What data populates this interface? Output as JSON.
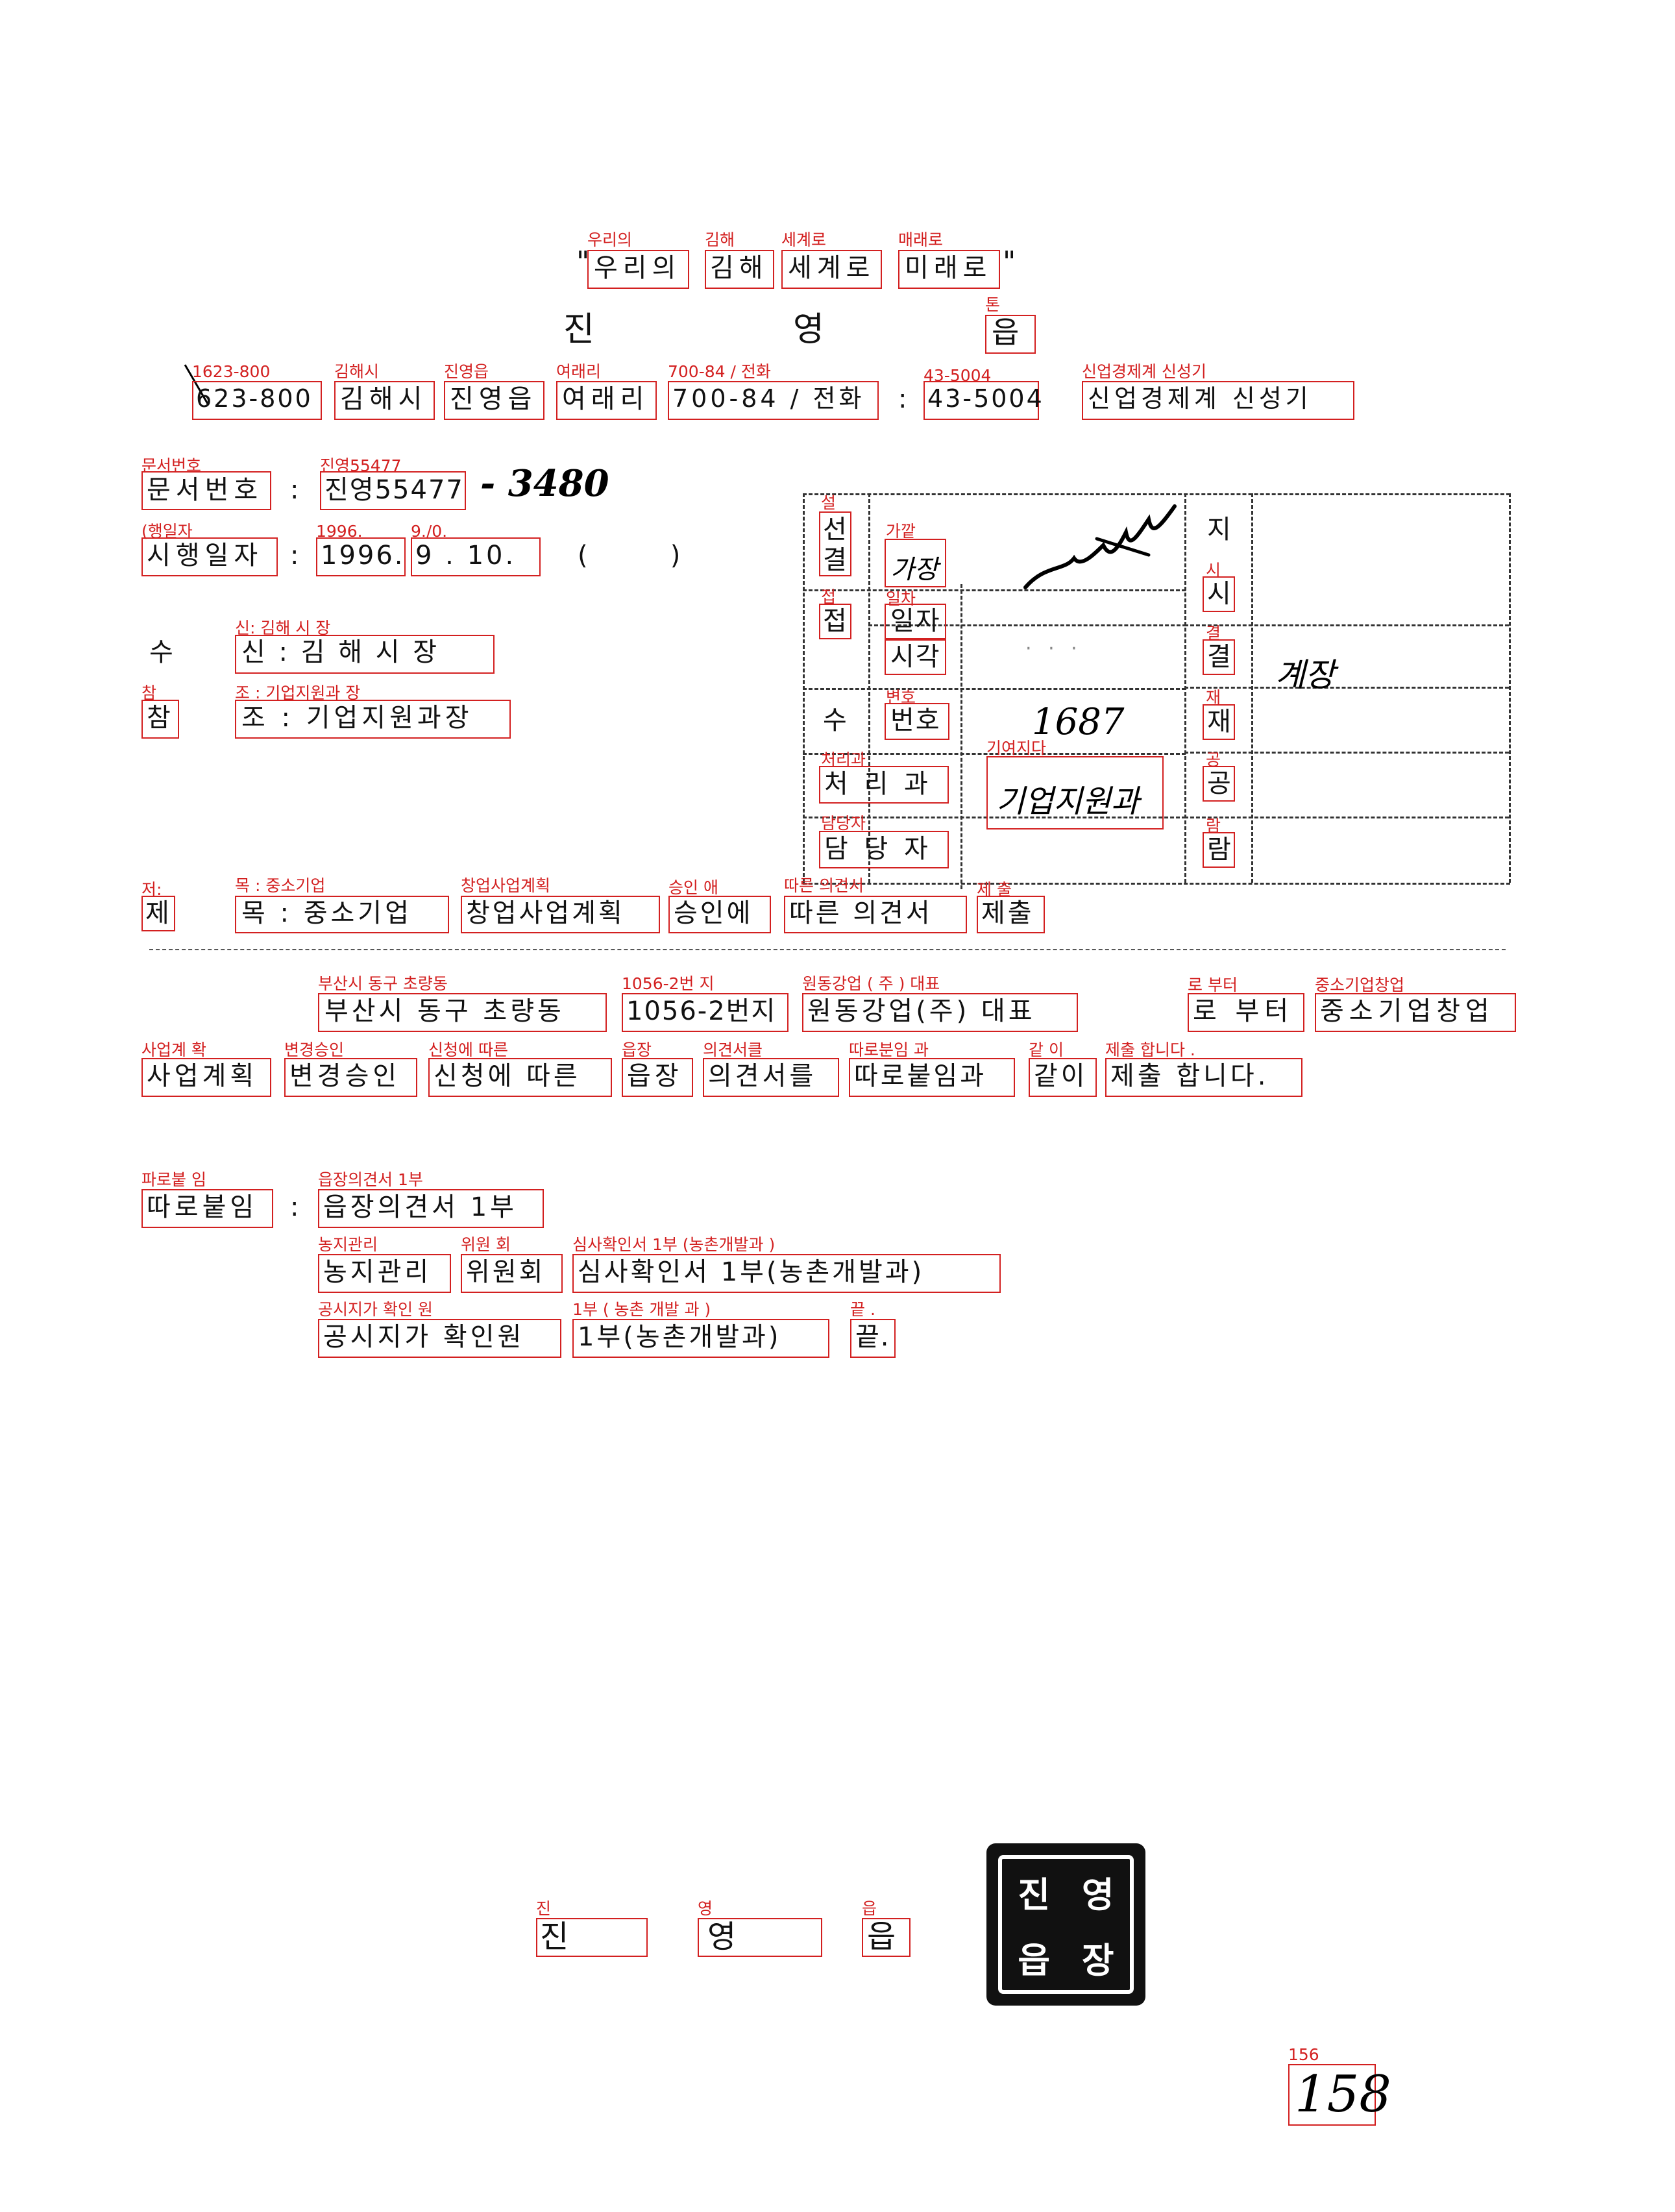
{
  "slogan": {
    "open_quote": "\"",
    "words": [
      "우리의",
      "김해",
      "세계로",
      "미래로"
    ],
    "close_quote": "\"",
    "annotations": [
      "우리의",
      "김해",
      "세계로",
      "매래로"
    ]
  },
  "issuer": {
    "name_chars": [
      "진",
      "영"
    ],
    "eup": "읍",
    "eup_annotation": "톤"
  },
  "address_line": {
    "postal": "623-800",
    "city": "김해시",
    "town": "진영읍",
    "village": "여래리",
    "street_phone": "700-84 / 전화",
    "colon": ":",
    "phone": "43-5004",
    "contact": "신업경제계 신성기",
    "annotations": {
      "postal": "1623-800",
      "city": "김해시",
      "town": "진영읍",
      "village": "여래리",
      "street_phone": "700-84 / 전화",
      "phone": "43-5004",
      "contact": "신업경제계 신성기"
    }
  },
  "doc_number": {
    "label": "문서번호",
    "colon": ":",
    "value": "진영55477",
    "suffix": "- 3480",
    "annotations": {
      "label": "문서번호",
      "value": "진영55477"
    }
  },
  "exec_date": {
    "label": "시행일자",
    "colon": ":",
    "year": "1996.",
    "month_day": "9 . 10.",
    "paren": "(          )",
    "annotations": {
      "label": "(행일자",
      "year": "1996.",
      "month_day": "9./0."
    }
  },
  "recipient": {
    "prefix": "수",
    "value": "신 : 김 해 시 장",
    "annotation": "신: 김해 시 장"
  },
  "reference": {
    "prefix": "참",
    "value": "조 : 기업지원과장",
    "annotations": {
      "prefix": "참",
      "value": "조 : 기업지원과 장"
    }
  },
  "approval_box": {
    "col1": [
      "선",
      "결",
      "접",
      "수"
    ],
    "col1_annotations": [
      "설",
      "접"
    ],
    "col2": [
      "가장",
      "일자",
      "시각",
      "번호"
    ],
    "col2_annotations": [
      "가깥",
      "일차",
      "변호"
    ],
    "handling_dept_label": "처 리 과",
    "handling_dept_annotation": "처리과",
    "handling_dept_value": "기업지원과",
    "handling_dept_value_annotation": "기여지다",
    "manager_label": "담 당 자",
    "manager_annotation": "담당자",
    "receipt_number": "1687",
    "right_col": [
      "지",
      "시",
      "결",
      "재",
      "공",
      "람"
    ],
    "right_col_annotations": [
      "시",
      "결",
      "재",
      "공",
      "람"
    ],
    "right_signature": "계장"
  },
  "subject": {
    "prefix": "제",
    "parts": [
      "목 : 중소기업",
      "창업사업계획",
      "승인에",
      "따른 의견서",
      "제출"
    ],
    "annotations": [
      "저:",
      "목 : 중소기업",
      "창업사업계획",
      "승인 애",
      "따른 의견서",
      "제 출"
    ]
  },
  "body_line1": {
    "parts": [
      "부산시 동구 초량동",
      "1056-2번지",
      "원동강업(주) 대표",
      "로 부터",
      "중소기업창업"
    ],
    "annotations": [
      "부산시 동구  초량동",
      "1056-2번 지",
      "원동강업 ( 주 )  대표",
      "로 부터",
      "중소기업창업"
    ]
  },
  "body_line2": {
    "parts": [
      "사업계획",
      "변경승인",
      "신청에 따른",
      "읍장",
      "의견서를",
      "따로붙임과",
      "같이",
      "제출 합니다."
    ],
    "annotations": [
      "사업계 확",
      "변경승인",
      "신청에  따른",
      "읍장",
      "의견서클",
      "따로분임 과",
      "같 이",
      "제출 합니다 ."
    ]
  },
  "attachments": {
    "label": "따로붙임",
    "colon": ":",
    "label_annotation": "파로붙 임",
    "items": [
      {
        "parts": [
          "읍장의견서 1부"
        ],
        "annotations": [
          "읍장의견서 1부"
        ]
      },
      {
        "parts": [
          "농지관리",
          "위원회",
          "심사확인서 1부(농촌개발과)"
        ],
        "annotations": [
          "농지관리",
          "위원 회",
          "심사확인서 1부 (농촌개발과 )"
        ]
      },
      {
        "parts": [
          "공시지가 확인원",
          "1부(농촌개발과)",
          "끝."
        ],
        "annotations": [
          "공시지가  확인 원",
          "1부 ( 농촌 개발 과 )",
          "끝 ."
        ]
      }
    ]
  },
  "signature": {
    "chars": [
      "진",
      "영",
      "읍"
    ],
    "annotations": [
      "진",
      "영",
      "읍"
    ],
    "seal_chars": [
      "진",
      "영",
      "읍",
      "장"
    ]
  },
  "page_number": {
    "value": "158",
    "annotation": "156"
  }
}
